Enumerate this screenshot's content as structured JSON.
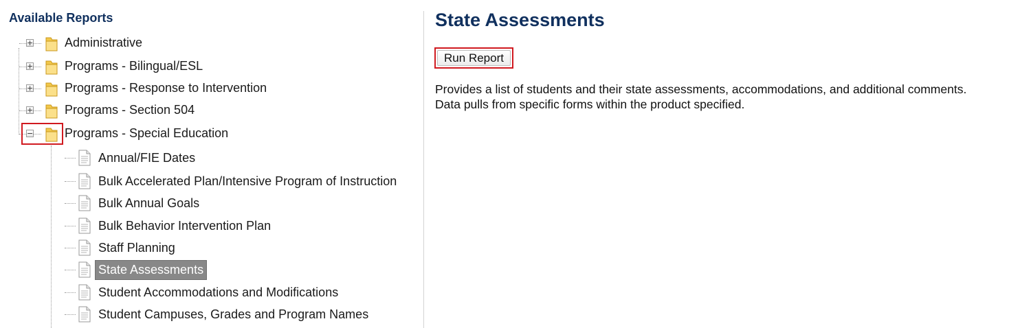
{
  "tree": {
    "title": "Available Reports",
    "folders": [
      {
        "label": "Administrative",
        "expanded": false,
        "icon": "folder-icon",
        "expander": "+"
      },
      {
        "label": "Programs - Bilingual/ESL",
        "expanded": false,
        "icon": "folder-icon",
        "expander": "+"
      },
      {
        "label": "Programs - Response to Intervention",
        "expanded": false,
        "icon": "folder-icon",
        "expander": "+"
      },
      {
        "label": "Programs - Section 504",
        "expanded": false,
        "icon": "folder-icon",
        "expander": "+"
      },
      {
        "label": "Programs - Special Education",
        "expanded": true,
        "icon": "folder-icon",
        "expander": "−"
      }
    ],
    "reports": [
      {
        "label": "Annual/FIE Dates",
        "icon": "document-icon"
      },
      {
        "label": "Bulk Accelerated Plan/Intensive Program of Instruction",
        "icon": "document-icon"
      },
      {
        "label": "Bulk Annual Goals",
        "icon": "document-icon"
      },
      {
        "label": "Bulk Behavior Intervention Plan",
        "icon": "document-icon"
      },
      {
        "label": "Staff Planning",
        "icon": "document-icon"
      },
      {
        "label": "State Assessments",
        "icon": "document-icon",
        "selected": true
      },
      {
        "label": "Student Accommodations and Modifications",
        "icon": "document-icon"
      },
      {
        "label": "Student Campuses, Grades and Program Names",
        "icon": "document-icon"
      }
    ]
  },
  "detail": {
    "title": "State Assessments",
    "run_button": "Run Report",
    "description_line1": "Provides a list of students and their state assessments, accommodations, and additional comments.",
    "description_line2": "Data pulls from specific forms within the product specified."
  },
  "colors": {
    "heading": "#10305e",
    "highlight": "#d0191f",
    "selected_bg": "#888888"
  }
}
